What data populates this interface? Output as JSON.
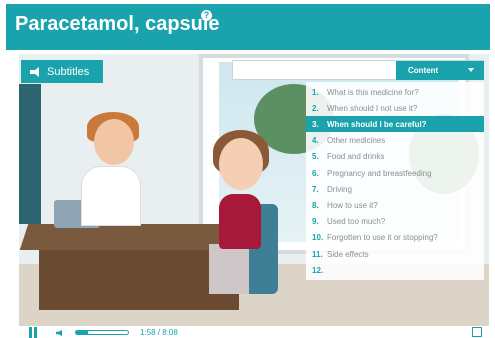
{
  "header": {
    "title": "Paracetamol, capsule",
    "info_icon": "info-icon"
  },
  "player": {
    "subtitles_label": "Subtitles",
    "content_label": "Content",
    "time": "1:58 / 8:08",
    "progress": 0.24
  },
  "menu": {
    "items": [
      {
        "num": "1.",
        "label": "What is this medicine for?",
        "active": false
      },
      {
        "num": "2.",
        "label": "When should I not use it?",
        "active": false
      },
      {
        "num": "3.",
        "label": "When should I be careful?",
        "active": true
      },
      {
        "num": "4.",
        "label": "Other medicines",
        "active": false
      },
      {
        "num": "5.",
        "label": "Food and drinks",
        "active": false
      },
      {
        "num": "6.",
        "label": "Pregnancy and breastfeeding",
        "active": false
      },
      {
        "num": "7.",
        "label": "Driving",
        "active": false
      },
      {
        "num": "8.",
        "label": "How to use it?",
        "active": false
      },
      {
        "num": "9.",
        "label": "Used too much?",
        "active": false
      },
      {
        "num": "10.",
        "label": "Forgotten to use it or stopping?",
        "active": false
      },
      {
        "num": "11.",
        "label": "Side effects",
        "active": false
      },
      {
        "num": "12.",
        "label": "",
        "active": false
      }
    ]
  },
  "colors": {
    "accent": "#1aa3ad",
    "menu_text": "#8a8f93"
  }
}
